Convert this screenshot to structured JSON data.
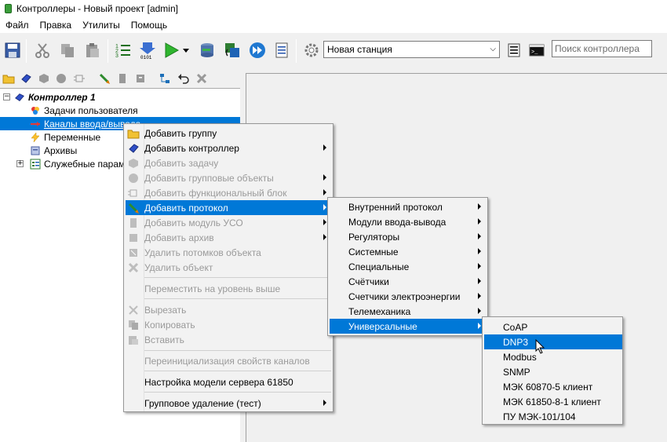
{
  "window": {
    "title": "Контроллеры - Новый проект [admin]"
  },
  "menubar": {
    "items": [
      "Файл",
      "Правка",
      "Утилиты",
      "Помощь"
    ]
  },
  "toolbar": {
    "station": "Новая станция",
    "search_placeholder": "Поиск контроллера"
  },
  "tree": {
    "root": "Контроллер 1",
    "items": [
      "Задачи пользователя",
      "Каналы ввода/вывода",
      "Переменные",
      "Архивы",
      "Служебные парам"
    ]
  },
  "context_menu": {
    "items": [
      {
        "label": "Добавить группу",
        "enabled": true
      },
      {
        "label": "Добавить контроллер",
        "enabled": true,
        "submenu": true
      },
      {
        "label": "Добавить задачу",
        "enabled": false
      },
      {
        "label": "Добавить групповые объекты",
        "enabled": false,
        "submenu": true
      },
      {
        "label": "Добавить функциональный блок",
        "enabled": false,
        "submenu": true
      },
      {
        "label": "Добавить протокол",
        "enabled": true,
        "submenu": true,
        "highlighted": true
      },
      {
        "label": "Добавить модуль УСО",
        "enabled": false,
        "submenu": true
      },
      {
        "label": "Добавить архив",
        "enabled": false,
        "submenu": true
      },
      {
        "label": "Удалить потомков объекта",
        "enabled": false
      },
      {
        "label": "Удалить объект",
        "enabled": false
      },
      {
        "label": "Переместить на уровень выше",
        "enabled": false
      },
      {
        "label": "Вырезать",
        "enabled": false
      },
      {
        "label": "Копировать",
        "enabled": false
      },
      {
        "label": "Вставить",
        "enabled": false
      },
      {
        "label": "Переинициализация свойств каналов",
        "enabled": false
      },
      {
        "label": "Настройка модели сервера 61850",
        "enabled": true
      },
      {
        "label": "Групповое удаление (тест)",
        "enabled": true,
        "submenu": true
      }
    ]
  },
  "protocol_submenu": {
    "items": [
      "Внутренний протокол",
      "Модули ввода-вывода",
      "Регуляторы",
      "Системные",
      "Специальные",
      "Счётчики",
      "Счетчики электроэнергии",
      "Телемеханика",
      "Универсальные"
    ]
  },
  "universal_submenu": {
    "items": [
      "CoAP",
      "DNP3",
      "Modbus",
      "SNMP",
      "МЭК 60870-5 клиент",
      "МЭК 61850-8-1 клиент",
      "ПУ МЭК-101/104"
    ]
  },
  "colors": {
    "selection": "#0078d7",
    "menu_bg": "#f2f2f2"
  }
}
